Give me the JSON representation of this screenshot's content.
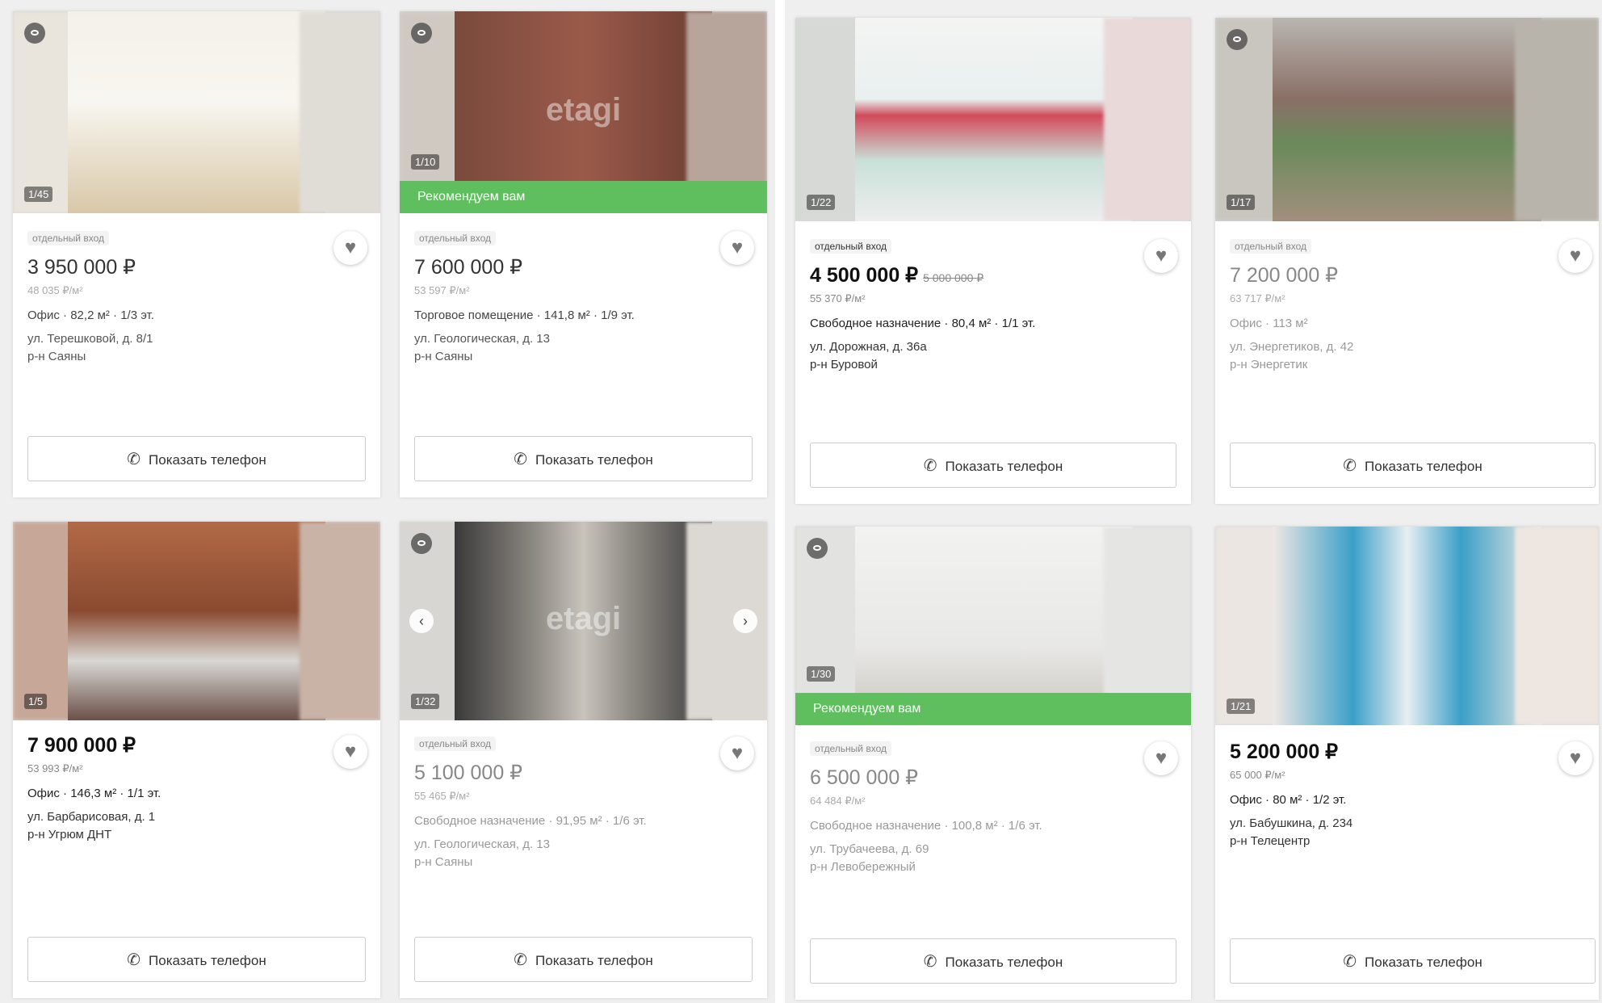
{
  "cards": [
    {
      "tag": "отдельный вход",
      "price": "3 950 000 ₽",
      "ppm": "48 035 ₽/м²",
      "info": "Офис · 82,2 м² · 1/3 эт.",
      "addr1": "ул. Терешковой, д. 8/1",
      "addr2": "р-н Саяны",
      "counter": "1/45",
      "button": "Показать телефон",
      "heart": "♥",
      "eye": "eye-icon",
      "phone": "phone-icon"
    },
    {
      "tag": "отдельный вход",
      "price": "7 600 000 ₽",
      "ppm": "53 597 ₽/м²",
      "info": "Торговое помещение · 141,8 м² · 1/9 эт.",
      "addr1": "ул. Геологическая, д. 13",
      "addr2": "р-н Саяны",
      "counter": "1/10",
      "reco": "Рекомендуем вам",
      "button": "Показать телефон",
      "watermark": "etagi"
    },
    {
      "tag": "отдельный вход",
      "price": "4 500 000 ₽",
      "old": "5 000 000 ₽",
      "ppm": "55 370 ₽/м²",
      "info": "Свободное назначение · 80,4 м² · 1/1 эт.",
      "addr1": "ул. Дорожная, д. 36а",
      "addr2": "р-н Буровой",
      "counter": "1/22",
      "button": "Показать телефон"
    },
    {
      "tag": "отдельный вход",
      "price": "7 200 000 ₽",
      "ppm": "63 717 ₽/м²",
      "info": "Офис · 113 м²",
      "addr1": "ул. Энергетиков, д. 42",
      "addr2": "р-н Энергетик",
      "counter": "1/17",
      "button": "Показать телефон"
    },
    {
      "tag": "",
      "price": "7 900 000 ₽",
      "ppm": "53 993 ₽/м²",
      "info": "Офис · 146,3 м² · 1/1 эт.",
      "addr1": "ул. Барбарисовая, д. 1",
      "addr2": "р-н Угрюм ДНТ",
      "counter": "1/5",
      "button": "Показать телефон"
    },
    {
      "tag": "отдельный вход",
      "price": "5 100 000 ₽",
      "ppm": "55 465 ₽/м²",
      "info": "Свободное назначение · 91,95 м² · 1/6 эт.",
      "addr1": "ул. Геологическая, д. 13",
      "addr2": "р-н Саяны",
      "counter": "1/32",
      "button": "Показать телефон",
      "watermark": "etagi"
    },
    {
      "tag": "отдельный вход",
      "price": "6 500 000 ₽",
      "ppm": "64 484 ₽/м²",
      "info": "Свободное назначение · 100,8 м² · 1/6 эт.",
      "addr1": "ул. Трубачеева, д. 69",
      "addr2": "р-н Левобережный",
      "counter": "1/30",
      "reco": "Рекомендуем вам",
      "button": "Показать телефон"
    },
    {
      "tag": "",
      "price": "5 200 000 ₽",
      "ppm": "65 000 ₽/м²",
      "info": "Офис · 80 м² · 1/2 эт.",
      "addr1": "ул. Бабушкина, д. 234",
      "addr2": "р-н Телецентр",
      "counter": "1/21",
      "button": "Показать телефон"
    }
  ],
  "colors": {
    "reco": "#5fbf5f",
    "card_bg": "#ffffff",
    "page_bg": "#efefef"
  },
  "icons": {
    "heart": "heart-icon",
    "phone": "phone-icon",
    "eye": "eye-icon",
    "prev": "chevron-left-icon",
    "next": "chevron-right-icon"
  }
}
